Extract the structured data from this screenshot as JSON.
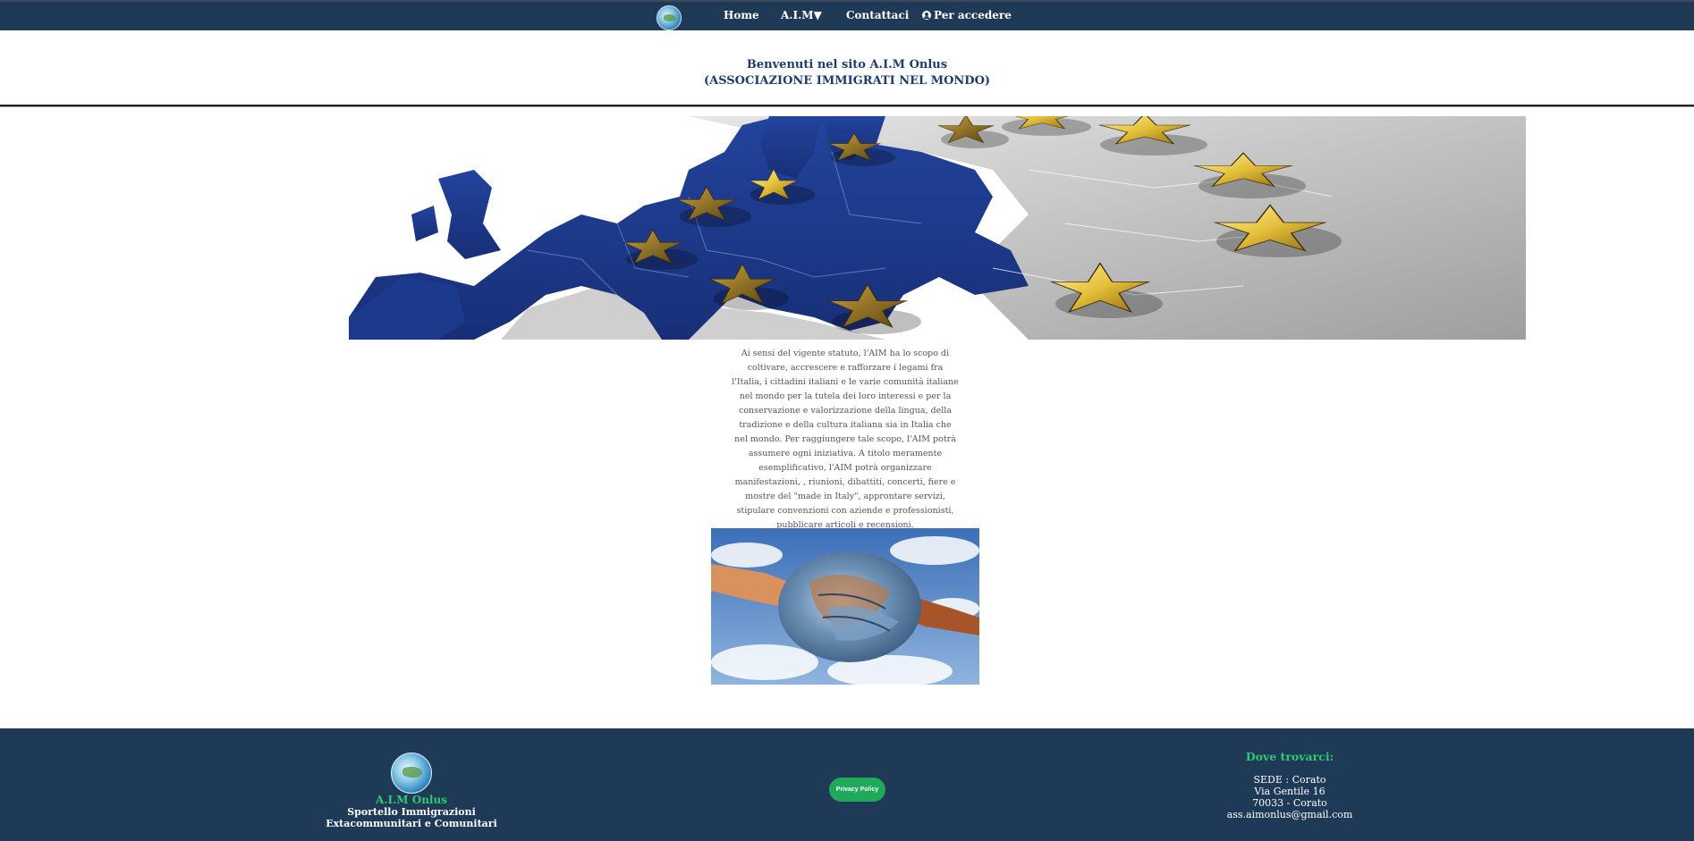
{
  "nav": {
    "home": "Home",
    "aim": "A.I.M▼",
    "contact": "Contattaci",
    "login": "Per accedere"
  },
  "welcome": {
    "line1": "Benvenuti nel sito A.I.M Onlus",
    "line2": "(ASSOCIAZIONE IMMIGRATI NEL MONDO)"
  },
  "statute": "Ai sensi del vigente statuto, l'AIM ha lo scopo di coltivare, accrescere e rafforzare i legami fra l'Italia, i cittadini italiani e le varie comunità italiane nel mondo per la tutela dei loro interessi e per la conservazione e valorizzazione della lingua, della tradizione e della cultura italiana sia in Italia che nel mondo. Per raggiungere tale scopo, l'AIM potrà assumere ogni iniziativa. A titolo meramente esemplificativo, l'AIM potrà organizzare manifestazioni, , riunioni, dibattiti, concerti, fiere e mostre del \"made in Italy\", approntare servizi, stipulare convenzioni con aziende e professionisti, pubblicare articoli e recensioni.",
  "footer": {
    "name": "A.I.M Onlus",
    "sub1": "Sportello Immigrazioni",
    "sub2": "Extacommunitari e Comunitari",
    "privacy": "Privacy Policy",
    "where_title": "Dove trovarci:",
    "addr1": "SEDE : Corato",
    "addr2": "Via Gentile 16",
    "addr3": "70033 - Corato",
    "addr4": "ass.aimonlus@gmail.com"
  },
  "colors": {
    "nav_bg": "#1f3a56",
    "accent_green": "#2ecc71",
    "eu_blue": "#1e3b8f",
    "star_gold": "#d9b030"
  },
  "icons": {
    "login": "user-circle-icon"
  }
}
